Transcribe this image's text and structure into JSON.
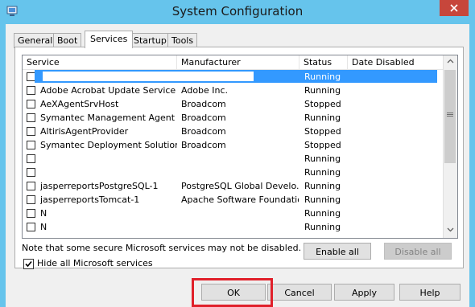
{
  "window": {
    "title": "System Configuration"
  },
  "tabs": [
    {
      "label": "General"
    },
    {
      "label": "Boot"
    },
    {
      "label": "Services",
      "active": true
    },
    {
      "label": "Startup"
    },
    {
      "label": "Tools"
    }
  ],
  "columns": {
    "service": "Service",
    "manufacturer": "Manufacturer",
    "status": "Status",
    "date_disabled": "Date Disabled"
  },
  "rows": [
    {
      "name": "",
      "manufacturer": "",
      "status": "Running",
      "selected": true
    },
    {
      "name": "Adobe Acrobat Update Service",
      "manufacturer": "Adobe Inc.",
      "status": "Running"
    },
    {
      "name": "AeXAgentSrvHost",
      "manufacturer": "Broadcom",
      "status": "Stopped"
    },
    {
      "name": "Symantec Management Agent",
      "manufacturer": "Broadcom",
      "status": "Running"
    },
    {
      "name": "AltirisAgentProvider",
      "manufacturer": "Broadcom",
      "status": "Stopped"
    },
    {
      "name": "Symantec Deployment Solution -...",
      "manufacturer": "Broadcom",
      "status": "Stopped"
    },
    {
      "name": "",
      "manufacturer": "",
      "status": "Running"
    },
    {
      "name": "",
      "manufacturer": "",
      "status": "Running"
    },
    {
      "name": "jasperreportsPostgreSQL-1",
      "manufacturer": "PostgreSQL Global Develo...",
      "status": "Running"
    },
    {
      "name": "jasperreportsTomcat-1",
      "manufacturer": "Apache Software Foundation",
      "status": "Running"
    },
    {
      "name": "N",
      "manufacturer": "",
      "status": "Running"
    },
    {
      "name": "N",
      "manufacturer": "",
      "status": "Running"
    }
  ],
  "note": "Note that some secure Microsoft services may not be disabled.",
  "buttons": {
    "enable_all": "Enable all",
    "disable_all": "Disable all",
    "ok": "OK",
    "cancel": "Cancel",
    "apply": "Apply",
    "help": "Help"
  },
  "hide_ms": {
    "label": "Hide all Microsoft services",
    "checked": true
  },
  "icons": {
    "app": "system-configuration-icon",
    "close": "close-icon",
    "scroll_up": "chevron-up-icon",
    "scroll_down": "chevron-down-icon",
    "grip": "scrollbar-grip-icon"
  },
  "colors": {
    "titlebar": "#66c4ec",
    "selection": "#3399ff",
    "highlight": "#e0202a",
    "close": "#c7463b"
  }
}
